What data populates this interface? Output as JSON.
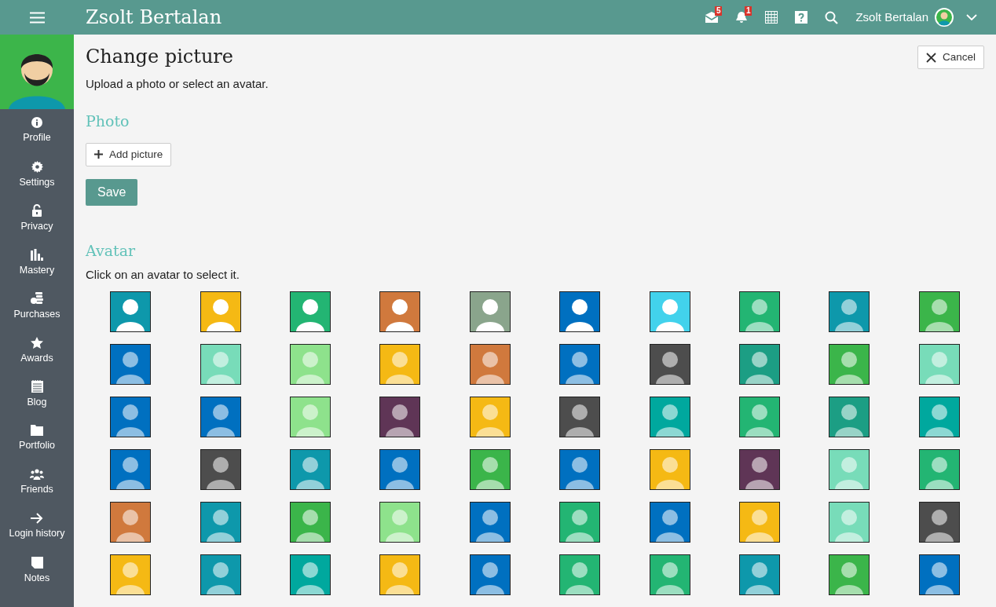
{
  "topbar": {
    "title": "Zsolt Bertalan",
    "icons": [
      {
        "kind": "mail",
        "badge": "5"
      },
      {
        "kind": "bell",
        "badge": "1"
      },
      {
        "kind": "calendar"
      },
      {
        "kind": "help"
      },
      {
        "kind": "search"
      }
    ],
    "user_name": "Zsolt Bertalan"
  },
  "sidebar": {
    "items": [
      {
        "kind": "info",
        "label": "Profile"
      },
      {
        "kind": "gear",
        "label": "Settings"
      },
      {
        "kind": "lock",
        "label": "Privacy"
      },
      {
        "kind": "bars",
        "label": "Mastery"
      },
      {
        "kind": "coins",
        "label": "Purchases"
      },
      {
        "kind": "star",
        "label": "Awards"
      },
      {
        "kind": "notepad",
        "label": "Blog"
      },
      {
        "kind": "folder",
        "label": "Portfolio"
      },
      {
        "kind": "people",
        "label": "Friends"
      },
      {
        "kind": "arrow",
        "label": "Login history"
      },
      {
        "kind": "note",
        "label": "Notes"
      }
    ]
  },
  "page": {
    "title": "Change picture",
    "subtitle": "Upload a photo or select an avatar.",
    "cancel_label": "Cancel"
  },
  "photo": {
    "heading": "Photo",
    "add_label": "Add picture",
    "save_label": "Save"
  },
  "avatar": {
    "heading": "Avatar",
    "hint": "Click on an avatar to select it.",
    "tiles": [
      {
        "kind": "blank",
        "color": "#0e98ab"
      },
      {
        "kind": "blank",
        "color": "#f5b914"
      },
      {
        "kind": "blank",
        "color": "#23b573"
      },
      {
        "kind": "blank",
        "color": "#d0793d"
      },
      {
        "kind": "blank",
        "color": "#8aa58c"
      },
      {
        "kind": "blank",
        "color": "#0070c0"
      },
      {
        "kind": "blank",
        "color": "#42d2ec"
      },
      {
        "kind": "person",
        "color": "#23b573"
      },
      {
        "kind": "person",
        "color": "#0e98ab"
      },
      {
        "kind": "person",
        "color": "#3bb54a"
      },
      {
        "kind": "person",
        "color": "#0070c0"
      },
      {
        "kind": "person",
        "color": "#78dcb9"
      },
      {
        "kind": "person",
        "color": "#8ee28c"
      },
      {
        "kind": "person",
        "color": "#f5b914"
      },
      {
        "kind": "person",
        "color": "#d0793d"
      },
      {
        "kind": "person",
        "color": "#0070c0"
      },
      {
        "kind": "person",
        "color": "#4d4d4d"
      },
      {
        "kind": "person",
        "color": "#1c9e84"
      },
      {
        "kind": "person",
        "color": "#3bb54a"
      },
      {
        "kind": "person",
        "color": "#78dcb9"
      },
      {
        "kind": "person",
        "color": "#0070c0"
      },
      {
        "kind": "person",
        "color": "#0070c0"
      },
      {
        "kind": "person",
        "color": "#8ee28c"
      },
      {
        "kind": "person",
        "color": "#5f3556"
      },
      {
        "kind": "person",
        "color": "#f5b914"
      },
      {
        "kind": "person",
        "color": "#4d4d4d"
      },
      {
        "kind": "person",
        "color": "#00a89e"
      },
      {
        "kind": "person",
        "color": "#23b573"
      },
      {
        "kind": "person",
        "color": "#1c9e84"
      },
      {
        "kind": "person",
        "color": "#00a89e"
      },
      {
        "kind": "person",
        "color": "#0070c0"
      },
      {
        "kind": "person",
        "color": "#4d4d4d"
      },
      {
        "kind": "person",
        "color": "#0e98ab"
      },
      {
        "kind": "person",
        "color": "#0070c0"
      },
      {
        "kind": "person",
        "color": "#3bb54a"
      },
      {
        "kind": "person",
        "color": "#0070c0"
      },
      {
        "kind": "person",
        "color": "#f5b914"
      },
      {
        "kind": "person",
        "color": "#5f3556"
      },
      {
        "kind": "person",
        "color": "#78dcb9"
      },
      {
        "kind": "person",
        "color": "#23b573"
      },
      {
        "kind": "person",
        "color": "#d0793d"
      },
      {
        "kind": "person",
        "color": "#0e98ab"
      },
      {
        "kind": "person",
        "color": "#3bb54a"
      },
      {
        "kind": "person",
        "color": "#8ee28c"
      },
      {
        "kind": "person",
        "color": "#0070c0"
      },
      {
        "kind": "person",
        "color": "#23b573"
      },
      {
        "kind": "person",
        "color": "#0070c0"
      },
      {
        "kind": "person",
        "color": "#f5b914"
      },
      {
        "kind": "person",
        "color": "#78dcb9"
      },
      {
        "kind": "person",
        "color": "#4d4d4d"
      },
      {
        "kind": "person",
        "color": "#f5b914"
      },
      {
        "kind": "person",
        "color": "#0e98ab"
      },
      {
        "kind": "person",
        "color": "#00a89e"
      },
      {
        "kind": "person",
        "color": "#f5b914"
      },
      {
        "kind": "person",
        "color": "#0070c0"
      },
      {
        "kind": "person",
        "color": "#23b573"
      },
      {
        "kind": "person",
        "color": "#23b573"
      },
      {
        "kind": "person",
        "color": "#0e98ab"
      },
      {
        "kind": "person",
        "color": "#3bb54a"
      },
      {
        "kind": "person",
        "color": "#0070c0"
      }
    ]
  }
}
